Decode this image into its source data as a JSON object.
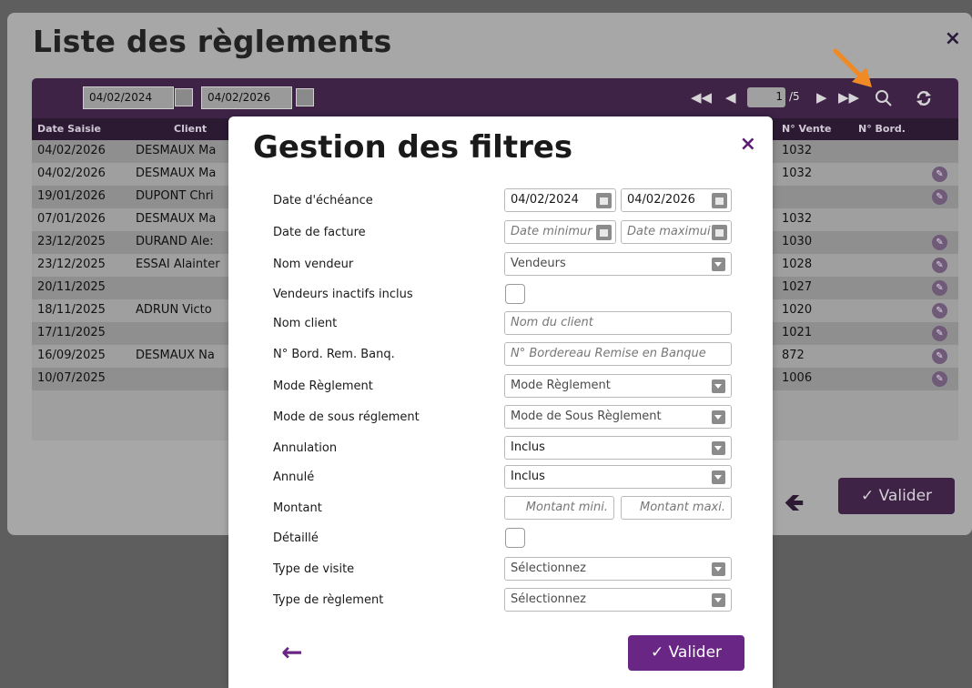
{
  "back": {
    "title": "Liste des règlements",
    "close": "×",
    "date_from": "04/02/2024",
    "date_to": "04/02/2026",
    "page_current": "1",
    "page_total": "/5",
    "headers": {
      "date": "Date Saisie",
      "client": "Client",
      "vente": "N° Vente",
      "bord": "N° Bord."
    },
    "rows": [
      {
        "date": "04/02/2026",
        "client": "DESMAUX Ma",
        "vente": "1032",
        "edit": false
      },
      {
        "date": "04/02/2026",
        "client": "DESMAUX Ma",
        "vente": "1032",
        "edit": true
      },
      {
        "date": "19/01/2026",
        "client": "DUPONT Chri",
        "vente": "",
        "edit": true
      },
      {
        "date": "07/01/2026",
        "client": "DESMAUX Ma",
        "vente": "1032",
        "edit": false
      },
      {
        "date": "23/12/2025",
        "client": "DURAND Ale:",
        "vente": "1030",
        "edit": true
      },
      {
        "date": "23/12/2025",
        "client": "ESSAI Alainter",
        "vente": "1028",
        "edit": true
      },
      {
        "date": "20/11/2025",
        "client": "",
        "vente": "1027",
        "edit": true
      },
      {
        "date": "18/11/2025",
        "client": "ADRUN Victo",
        "vente": "1020",
        "edit": true
      },
      {
        "date": "17/11/2025",
        "client": "",
        "vente": "1021",
        "edit": true
      },
      {
        "date": "16/09/2025",
        "client": "DESMAUX Na",
        "vente": "872",
        "edit": true
      },
      {
        "date": "10/07/2025",
        "client": "",
        "vente": "1006",
        "edit": true
      }
    ],
    "valider": "✓  Valider"
  },
  "modal": {
    "title": "Gestion des filtres",
    "close": "×",
    "fields": {
      "date_echeance": {
        "label": "Date d'échéance",
        "from": "04/02/2024",
        "to": "04/02/2026"
      },
      "date_facture": {
        "label": "Date de facture",
        "from_placeholder": "Date minimur",
        "to_placeholder": "Date maximui"
      },
      "nom_vendeur": {
        "label": "Nom vendeur",
        "value": "Vendeurs"
      },
      "vendeurs_inactifs": {
        "label": "Vendeurs inactifs inclus"
      },
      "nom_client": {
        "label": "Nom client",
        "placeholder": "Nom du client"
      },
      "bordereau": {
        "label": "N° Bord. Rem. Banq.",
        "placeholder": "N° Bordereau Remise en Banque"
      },
      "mode_reglement": {
        "label": "Mode Règlement",
        "value": "Mode Règlement"
      },
      "mode_sous_reglement": {
        "label": "Mode de sous réglement",
        "value": "Mode de Sous Règlement"
      },
      "annulation": {
        "label": "Annulation",
        "value": "Inclus"
      },
      "annule": {
        "label": "Annulé",
        "value": "Inclus"
      },
      "montant": {
        "label": "Montant",
        "min_placeholder": "Montant mini.",
        "max_placeholder": "Montant maxi."
      },
      "detaille": {
        "label": "Détaillé"
      },
      "type_visite": {
        "label": "Type de visite",
        "value": "Sélectionnez"
      },
      "type_reglement": {
        "label": "Type de règlement",
        "value": "Sélectionnez"
      }
    },
    "back_arrow": "←",
    "valider": "✓  Valider"
  }
}
